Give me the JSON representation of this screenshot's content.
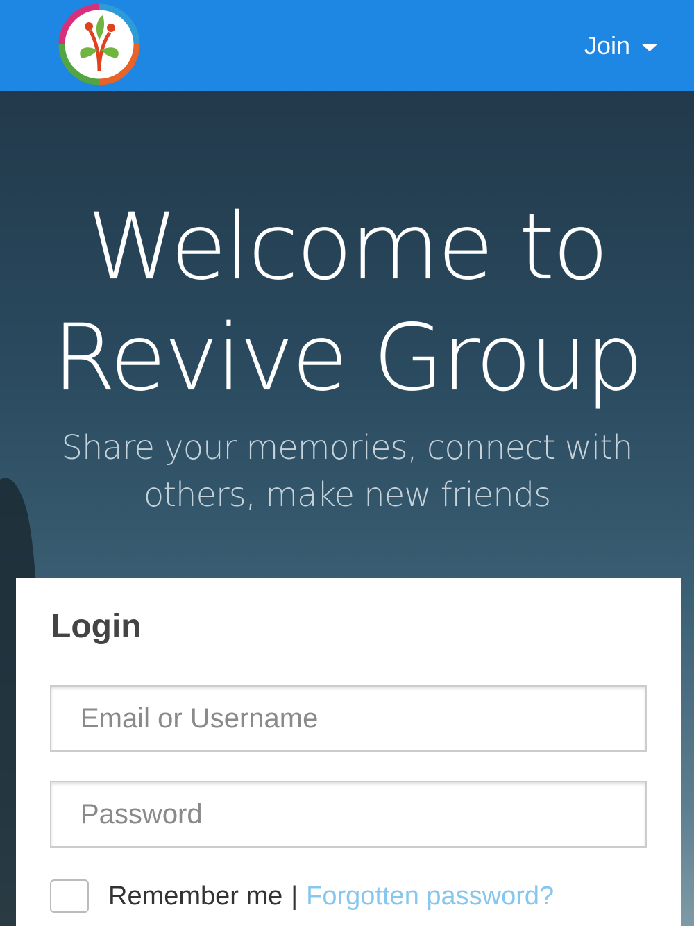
{
  "navbar": {
    "join_label": "Join",
    "background_color": "#1e86e3",
    "logo_icon": "revive-group-logo-icon"
  },
  "hero": {
    "title_line1": "Welcome to",
    "title_line2": "Revive Group",
    "subtitle_line1": "Share your memories, connect with",
    "subtitle_line2": "others, make new friends"
  },
  "login": {
    "title": "Login",
    "email_placeholder": "Email or Username",
    "password_placeholder": "Password",
    "remember_label": "Remember me",
    "separator": "|",
    "forgot_label": "Forgotten password?",
    "link_color": "#87c7ee"
  }
}
